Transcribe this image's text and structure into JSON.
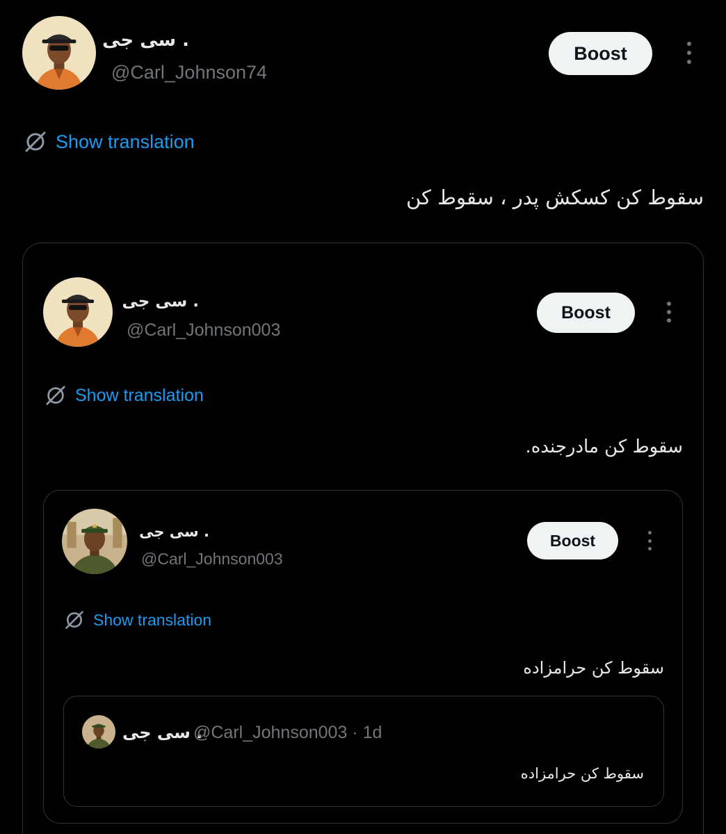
{
  "main_post": {
    "display_name": "سی جی .",
    "handle": "@Carl_Johnson74",
    "boost_label": "Boost",
    "translate_label": "Show translation",
    "text": "سقوط کن کسکش پدر ، سقوط کن"
  },
  "quote_1": {
    "display_name": "سی جی .",
    "handle": "@Carl_Johnson003",
    "boost_label": "Boost",
    "translate_label": "Show translation",
    "text": "سقوط کن مادرجنده."
  },
  "quote_2": {
    "display_name": "سی جی .",
    "handle": "@Carl_Johnson003",
    "boost_label": "Boost",
    "translate_label": "Show translation",
    "text": "سقوط کن حرامزاده"
  },
  "quote_3": {
    "display_name": "سی جی .",
    "handle_time": "@Carl_Johnson003 · 1d",
    "text": "سقوط کن حرامزاده"
  },
  "colors": {
    "background": "#000000",
    "link": "#1d9bf0",
    "secondary_text": "#71767b",
    "button_bg": "#eff3f4"
  }
}
